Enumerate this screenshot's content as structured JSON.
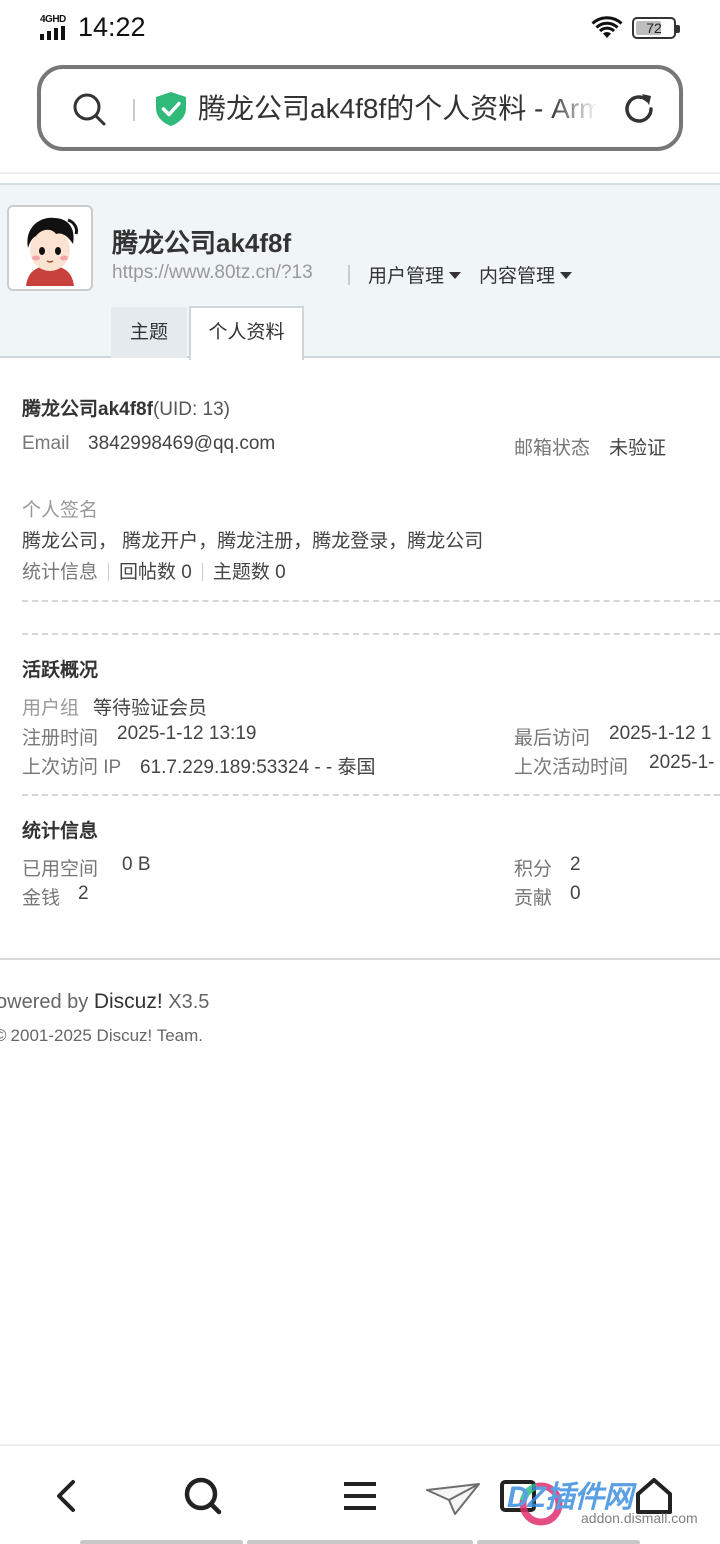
{
  "status_bar": {
    "network": "4GHD",
    "time": "14:22",
    "battery": "72",
    "battery_level_percent": 72
  },
  "address_bar": {
    "page_title": "腾龙公司ak4f8f的个人资料 - Arm"
  },
  "profile": {
    "username": "腾龙公司ak4f8f",
    "site_url": "https://www.80tz.cn/?13",
    "menu_user_manage": "用户管理",
    "menu_content_manage": "内容管理",
    "tabs": [
      {
        "label": "主题",
        "active": false
      },
      {
        "label": "个人资料",
        "active": true
      }
    ]
  },
  "basic_info": {
    "name": "腾龙公司ak4f8f",
    "uid": "(UID: 13)",
    "email_label": "Email",
    "email": "3842998469@qq.com",
    "mail_status_label": "邮箱状态",
    "mail_status": "未验证",
    "signature_label": "个人签名",
    "signature": "腾龙公司， 腾龙开户，腾龙注册，腾龙登录，腾龙公司",
    "stats_label": "统计信息",
    "replies": "回帖数 0",
    "topics": "主题数 0"
  },
  "activity": {
    "heading": "活跃概况",
    "group_label": "用户组",
    "group": "等待验证会员",
    "reg_time_label": "注册时间",
    "reg_time": "2025-1-12 13:19",
    "last_visit_label": "最后访问",
    "last_visit": "2025-1-12 1",
    "last_ip_label": "上次访问 IP",
    "last_ip": "61.7.229.189:53324 - - 泰国",
    "last_active_label": "上次活动时间",
    "last_active": "2025-1-"
  },
  "statistics": {
    "heading": "统计信息",
    "space_label": "已用空间",
    "space": "0 B",
    "credits_label": "积分",
    "credits": "2",
    "money_label": "金钱",
    "money": "2",
    "contrib_label": "贡献",
    "contrib": "0"
  },
  "footer": {
    "powered_prefix": "owered by ",
    "powered_brand": "Discuz!",
    "powered_version": " X3.5",
    "copyright": "2001-2025 Discuz! Team."
  },
  "watermark": {
    "text": "DZ插件网",
    "domain": "addon.dismall.com"
  },
  "colors": {
    "header_bg": "#f0f6f8",
    "shield_green": "#2fba7a",
    "text_dark": "#333333",
    "text_muted": "#999999"
  }
}
